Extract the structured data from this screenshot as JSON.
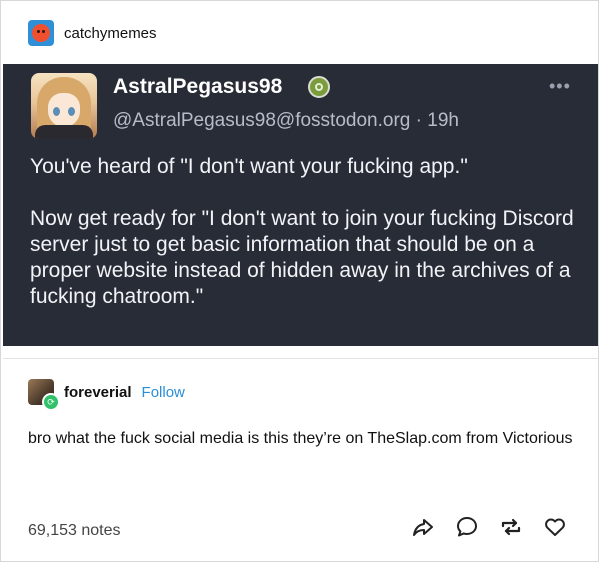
{
  "post": {
    "blog_name": "catchymemes"
  },
  "toot": {
    "display_name": "AstralPegasus98",
    "handle": "@AstralPegasus98@fosstodon.org",
    "separator": "·",
    "time": "19h",
    "more_icon": "more-horizontal-icon",
    "paragraphs": [
      "You've heard of \"I don't want your fucking app.\"",
      "Now get ready for \"I don't want to join your fucking Discord server just to get basic information that should be on a proper website instead of hidden away in the archives of a fucking chatroom.\""
    ]
  },
  "reblog": {
    "username": "foreverial",
    "follow_label": "Follow",
    "text": "bro what the fuck social media is this they’re on TheSlap.com from Victorious"
  },
  "footer": {
    "notes": "69,153 notes",
    "icons": [
      "share-icon",
      "reply-icon",
      "reblog-icon",
      "like-icon"
    ]
  },
  "colors": {
    "toot_background": "#282c37",
    "follow_link": "#2a8fd8",
    "verified_badge": "#7a9c3c"
  }
}
